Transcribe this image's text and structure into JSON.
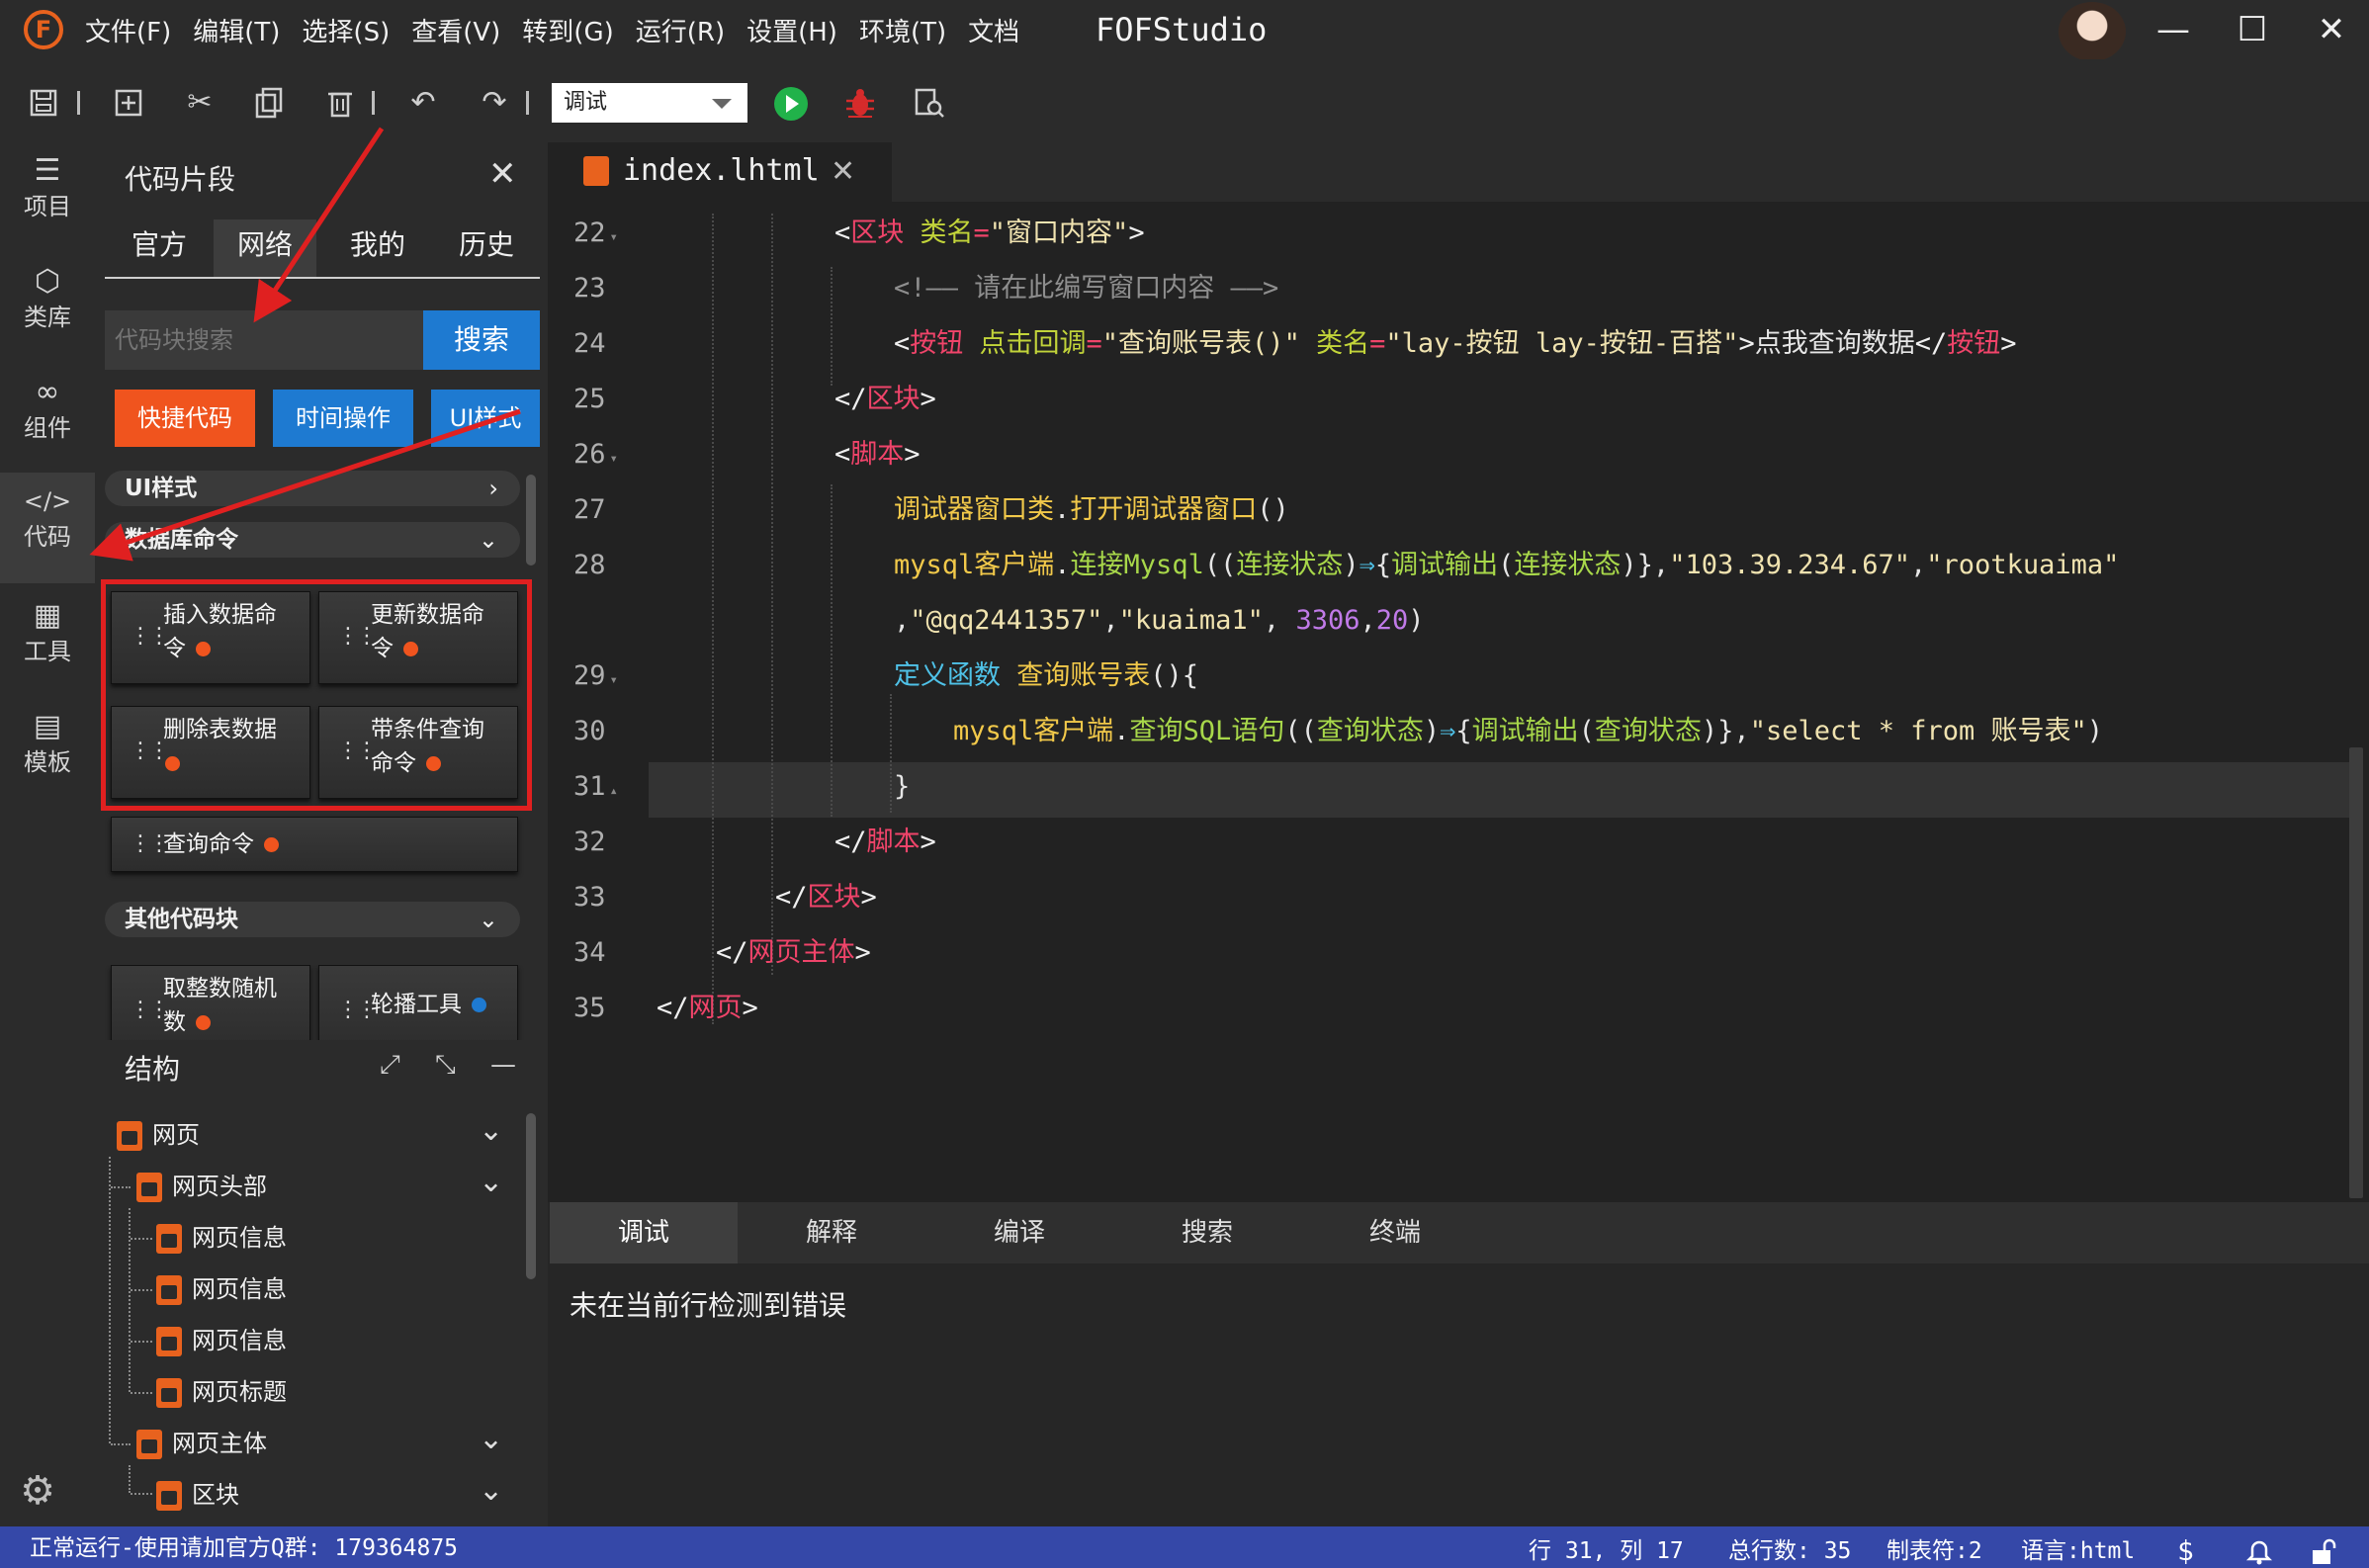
{
  "titlebar": {
    "menu": [
      "文件(F)",
      "编辑(T)",
      "选择(S)",
      "查看(V)",
      "转到(G)",
      "运行(R)",
      "设置(H)",
      "环境(T)",
      "文档"
    ],
    "app_title": "FOFStudio",
    "logo_letter": "F",
    "minimize": "—",
    "maximize": "☐",
    "close": "✕"
  },
  "toolbar": {
    "mode": "调试"
  },
  "activity": {
    "items": [
      {
        "label": "项目",
        "icon": "layers-icon",
        "glyph": "☰"
      },
      {
        "label": "类库",
        "icon": "cube-icon",
        "glyph": "⬡"
      },
      {
        "label": "组件",
        "icon": "infinity-icon",
        "glyph": "∞"
      },
      {
        "label": "代码",
        "icon": "code-icon",
        "glyph": "</>"
      },
      {
        "label": "工具",
        "icon": "grid-icon",
        "glyph": "▦"
      },
      {
        "label": "模板",
        "icon": "template-icon",
        "glyph": "▤"
      }
    ],
    "active": 3
  },
  "snippets": {
    "title": "代码片段",
    "tabs": [
      "官方",
      "网络",
      "我的",
      "历史"
    ],
    "active_tab": 1,
    "search_placeholder": "代码块搜索",
    "search_button": "搜索",
    "categories": [
      {
        "label": "快捷代码",
        "color": "#f0541e"
      },
      {
        "label": "时间操作",
        "color": "#1e7ad1"
      },
      {
        "label": "UI样式",
        "color": "#1e7ad1"
      }
    ],
    "groups": {
      "ui": "UI样式",
      "db": "数据库命令",
      "other": "其他代码块"
    },
    "db_items": [
      {
        "line1": "插入数据命",
        "line2": "令"
      },
      {
        "line1": "更新数据命",
        "line2": "令"
      },
      {
        "line1": "删除表数据",
        "line2": ""
      },
      {
        "line1": "带条件查询",
        "line2": "命令"
      }
    ],
    "query_item": "查询命令",
    "other_items": [
      {
        "line1": "取整数随机",
        "line2": "数"
      },
      {
        "line1": "轮播工具",
        "line2": ""
      }
    ]
  },
  "structure": {
    "title": "结构",
    "expand": "⤢",
    "collapse": "⤡",
    "minimize": "—",
    "nodes": [
      "网页",
      "网页头部",
      "网页信息",
      "网页信息",
      "网页信息",
      "网页标题",
      "网页主体",
      "区块"
    ]
  },
  "editor": {
    "file_name": "index.lhtml",
    "line_numbers": [
      "22",
      "23",
      "24",
      "25",
      "26",
      "27",
      "28",
      "",
      "29",
      "30",
      "31",
      "32",
      "33",
      "34",
      "35"
    ]
  },
  "output": {
    "tabs": [
      "调试",
      "解释",
      "编译",
      "搜索",
      "终端"
    ],
    "active_tab": 0,
    "message": "未在当前行检测到错误"
  },
  "status": {
    "left": "正常运行-使用请加官方Q群: 179364875",
    "position": "行 31, 列 17",
    "total_lines": "总行数: 35",
    "tab_size": "制表符:2",
    "language": "语言:html"
  }
}
